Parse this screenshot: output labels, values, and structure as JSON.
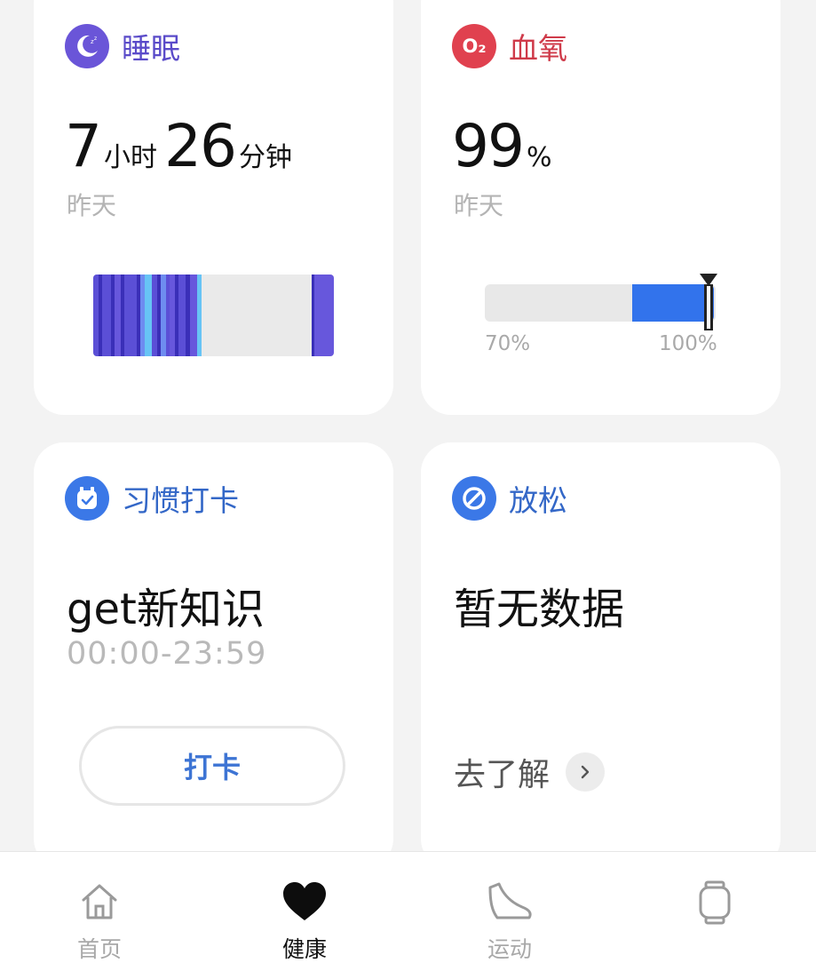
{
  "colors": {
    "sleep_accent": "#6a55d8",
    "oxygen_accent": "#e0414f",
    "habit_accent": "#3b78e7",
    "relax_accent": "#3b78e7",
    "oxygen_fill": "#3273ec"
  },
  "sleep": {
    "title": "睡眠",
    "icon": "moon-zzz-icon",
    "hours": "7",
    "hours_unit": "小时",
    "minutes": "26",
    "minutes_unit": "分钟",
    "day": "昨天"
  },
  "oxygen": {
    "title": "血氧",
    "icon": "o2-icon",
    "icon_text": "O₂",
    "value": "99",
    "unit": "%",
    "day": "昨天",
    "min_label": "70%",
    "max_label": "100%",
    "value_fraction": 0.97
  },
  "habit": {
    "title": "习惯打卡",
    "icon": "alarm-check-icon",
    "name": "get新知识",
    "time_range": "00:00-23:59",
    "button_label": "打卡"
  },
  "relax": {
    "title": "放松",
    "icon": "relax-circle-icon",
    "empty_text": "暂无数据",
    "learn_more": "去了解"
  },
  "nav": {
    "items": [
      {
        "label": "首页",
        "icon": "home-icon"
      },
      {
        "label": "健康",
        "icon": "heart-icon",
        "active": true
      },
      {
        "label": "运动",
        "icon": "shoe-icon"
      },
      {
        "label": "",
        "icon": "watch-icon"
      }
    ]
  }
}
